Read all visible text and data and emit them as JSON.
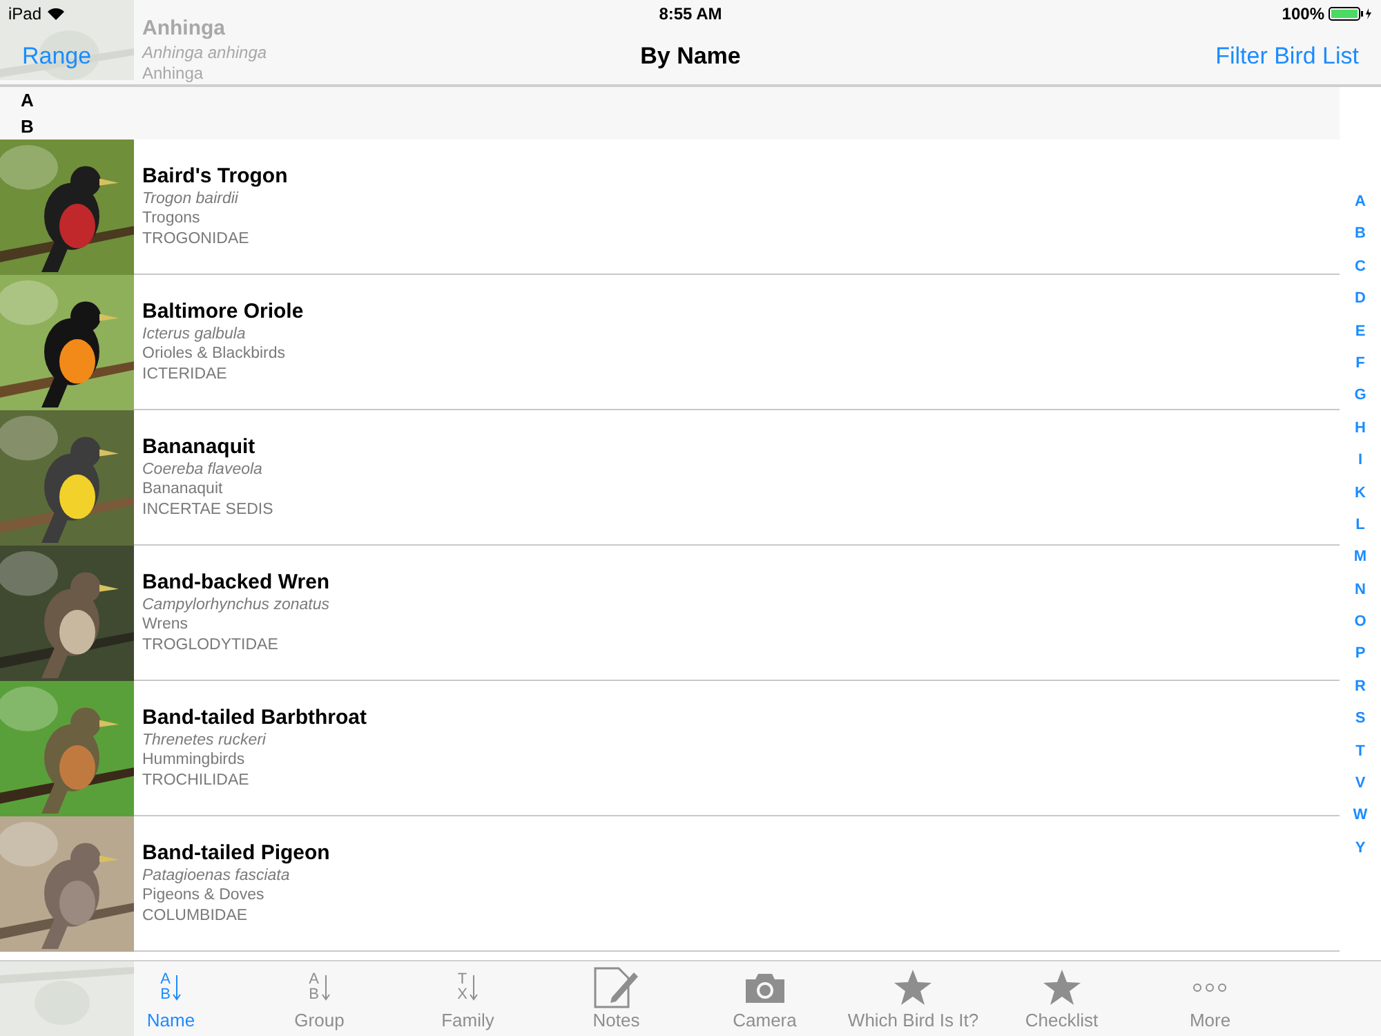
{
  "status_bar": {
    "device": "iPad",
    "time": "8:55 AM",
    "battery": "100%"
  },
  "nav_bar": {
    "left_button": "Range",
    "title": "By Name",
    "right_button": "Filter Bird List"
  },
  "peek_top": {
    "name": "Anhinga",
    "scientific": "Anhinga anhinga",
    "group": "Anhinga"
  },
  "section_headers": [
    "A",
    "B"
  ],
  "birds": [
    {
      "name": "Baird's Trogon",
      "scientific": "Trogon bairdii",
      "group": "Trogons",
      "family": "TROGONIDAE"
    },
    {
      "name": "Baltimore Oriole",
      "scientific": "Icterus galbula",
      "group": "Orioles & Blackbirds",
      "family": "ICTERIDAE"
    },
    {
      "name": "Bananaquit",
      "scientific": "Coereba flaveola",
      "group": "Bananaquit",
      "family": "INCERTAE SEDIS"
    },
    {
      "name": "Band-backed Wren",
      "scientific": "Campylorhynchus zonatus",
      "group": "Wrens",
      "family": "TROGLODYTIDAE"
    },
    {
      "name": "Band-tailed Barbthroat",
      "scientific": "Threnetes ruckeri",
      "group": "Hummingbirds",
      "family": "TROCHILIDAE"
    },
    {
      "name": "Band-tailed Pigeon",
      "scientific": "Patagioenas fasciata",
      "group": "Pigeons & Doves",
      "family": "COLUMBIDAE"
    }
  ],
  "index_letters": [
    "A",
    "B",
    "C",
    "D",
    "E",
    "F",
    "G",
    "H",
    "I",
    "K",
    "L",
    "M",
    "N",
    "O",
    "P",
    "R",
    "S",
    "T",
    "V",
    "W",
    "Y"
  ],
  "tabs": [
    {
      "label": "Name",
      "kind": "sort",
      "letters": [
        "A",
        "B"
      ],
      "selected": true
    },
    {
      "label": "Group",
      "kind": "sort",
      "letters": [
        "A",
        "B"
      ],
      "selected": false
    },
    {
      "label": "Family",
      "kind": "sort",
      "letters": [
        "T",
        "X"
      ],
      "selected": false
    },
    {
      "label": "Notes",
      "kind": "notes",
      "selected": false
    },
    {
      "label": "Camera",
      "kind": "camera",
      "selected": false
    },
    {
      "label": "Which Bird Is It?",
      "kind": "star",
      "selected": false
    },
    {
      "label": "Checklist",
      "kind": "star",
      "selected": false
    },
    {
      "label": "More",
      "kind": "more",
      "selected": false
    }
  ]
}
